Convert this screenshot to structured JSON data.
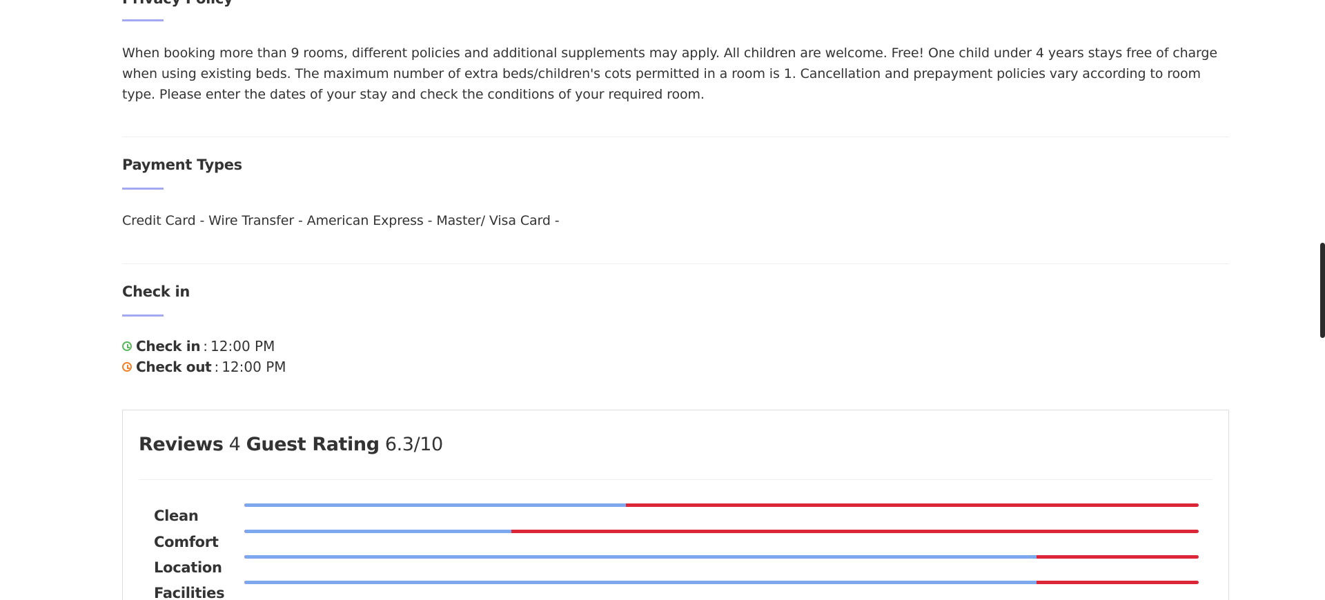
{
  "privacy": {
    "title": "Privacy Policy",
    "text": "When booking more than 9 rooms, different policies and additional supplements may apply. All children are welcome. Free! One child under 4 years stays free of charge when using existing beds. The maximum number of extra beds/children's cots permitted in a room is 1. Cancellation and prepayment policies vary according to room type. Please enter the dates of your stay and check the conditions of your required room."
  },
  "payment": {
    "title": "Payment Types",
    "text": "Credit Card - Wire Transfer - American Express - Master/ Visa Card -"
  },
  "checkin": {
    "title": "Check in",
    "checkin_label": "Check in",
    "checkin_time": "12:00 PM",
    "checkout_label": "Check out",
    "checkout_time": "12:00 PM",
    "separator": ":",
    "checkin_icon_color": "#5cb85c",
    "checkout_icon_color": "#f0832a"
  },
  "reviews": {
    "reviews_label": "Reviews",
    "reviews_count": "4",
    "guest_rating_label": "Guest Rating",
    "guest_rating_value": "6.3/10",
    "ratings": [
      {
        "label": "Clean",
        "fraction": 0.4
      },
      {
        "label": "Comfort",
        "fraction": 0.28
      },
      {
        "label": "Location",
        "fraction": 0.83
      },
      {
        "label": "Facilities",
        "fraction": 0.83
      }
    ]
  },
  "colors": {
    "accent_underline": "#a3a8f2",
    "bar_fill": "#7ea8ee",
    "bar_remainder": "#dc2637"
  }
}
